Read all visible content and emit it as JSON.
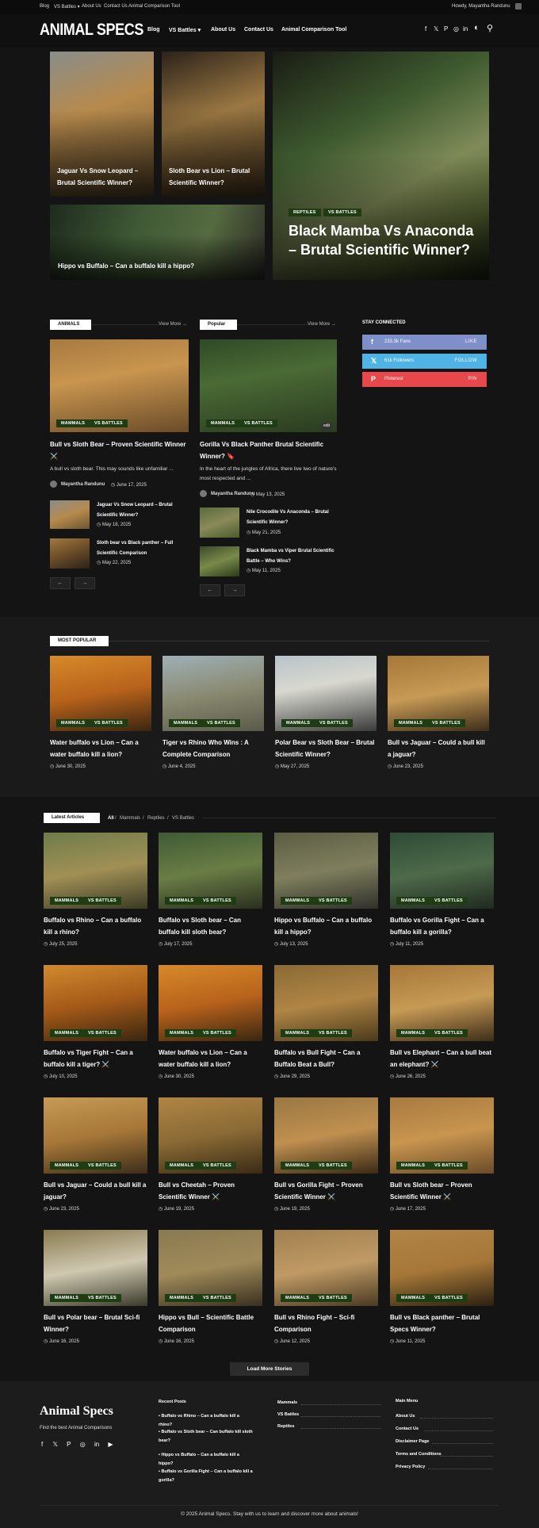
{
  "topbar": {
    "links": [
      "Blog",
      "VS Battles ▾",
      "About Us",
      "Contact Us",
      "Animal Comparison Tool"
    ],
    "greeting": "Howdy, Mayantha Randunu"
  },
  "header": {
    "logo": "ANIMAL SPECS",
    "nav": [
      "Blog",
      "VS Battles ▾",
      "About Us",
      "Contact Us",
      "Animal Comparison Tool"
    ],
    "icons": [
      "f",
      "𝕏",
      "P",
      "◎",
      "in",
      "◐",
      "⚲"
    ]
  },
  "hero": {
    "small": [
      {
        "title": "Jaguar Vs Snow Leopard – Brutal Scientific Winner?"
      },
      {
        "title": "Sloth Bear vs Lion – Brutal Scientific Winner?"
      },
      {
        "title": "Hippo vs Buffalo – Can a buffalo kill a hippo?"
      }
    ],
    "big": {
      "tags": [
        "REPTILES",
        "VS BATTLES"
      ],
      "title": "Black Mamba Vs Anaconda – Brutal Scientific Winner?"
    }
  },
  "animals": {
    "label": "ANIMALS",
    "view_more": "View More →",
    "main": {
      "tags": [
        "MAMMALS",
        "VS BATTLES"
      ],
      "title": "Bull vs Sloth Bear – Proven Scientific Winner ⚔️",
      "excerpt": "A bull vs sloth bear. This may sounds like unfamiliar ...",
      "author": "Mayantha Randunu",
      "date": "June 17, 2025"
    },
    "list": [
      {
        "title": "Jaguar Vs Snow Leopard – Brutal Scientific Winner?",
        "date": "May 18, 2025"
      },
      {
        "title": "Sloth bear vs Black panther – Full Scientific Comparison",
        "date": "May 22, 2025"
      }
    ],
    "prev": "←",
    "next": "→"
  },
  "popular": {
    "label": "Popular",
    "view_more": "View More →",
    "main": {
      "tags": [
        "MAMMALS",
        "VS BATTLES"
      ],
      "edit": "edit",
      "title": "Gorilla Vs Black Panther Brutal Scientific Winner? 🔖",
      "excerpt": "In the heart of the jungles of Africa, there live two of nature's most respected and ...",
      "author": "Mayantha Randunu",
      "date": "May 13, 2025"
    },
    "list": [
      {
        "title": "Nile Crocodile Vs Anaconda – Brutal Scientific Winner?",
        "date": "May 21, 2025"
      },
      {
        "title": "Black Mamba vs Viper Brutal Scientific Battle – Who Wins?",
        "date": "May 11, 2025"
      }
    ],
    "prev": "←",
    "next": "→"
  },
  "stay": {
    "label": "STAY CONNECTED",
    "items": [
      {
        "icon": "f",
        "count": "233.3k Fans",
        "action": "LIKE",
        "color": "#7f8fc9"
      },
      {
        "icon": "𝕏",
        "count": "61k Followers",
        "action": "FOLLOW",
        "color": "#4fb3e6"
      },
      {
        "icon": "P",
        "count": "Pinterest",
        "action": "PIN",
        "color": "#e8474c"
      }
    ]
  },
  "most_popular": {
    "label": "MOST POPULAR",
    "items": [
      {
        "tags": [
          "MAMMALS",
          "VS BATTLES"
        ],
        "title": "Water buffalo vs Lion – Can a water buffalo kill a lion?",
        "date": "June 30, 2025"
      },
      {
        "tags": [
          "MAMMALS",
          "VS BATTLES"
        ],
        "title": "Tiger vs Rhino Who Wins : A Complete Comparison",
        "date": "June 4, 2025"
      },
      {
        "tags": [
          "MAMMALS",
          "VS BATTLES"
        ],
        "title": "Polar Bear vs Sloth Bear – Brutal Scientific Winner?",
        "date": "May 27, 2025"
      },
      {
        "tags": [
          "MAMMALS",
          "VS BATTLES"
        ],
        "title": "Bull vs Jaguar – Could a bull kill a jaguar?",
        "date": "June 23, 2025"
      }
    ]
  },
  "latest": {
    "label": "Latest Articles",
    "filters": [
      "All",
      "Mammals",
      "Reptiles",
      "VS Battles"
    ],
    "items": [
      {
        "title": "Buffalo vs Rhino – Can a buffalo kill a rhino?",
        "date": "July 25, 2025"
      },
      {
        "title": "Buffalo vs Sloth bear – Can buffalo kill sloth bear?",
        "date": "July 17, 2025"
      },
      {
        "title": "Hippo vs Buffalo – Can a buffalo kill a hippo?",
        "date": "July 13, 2025"
      },
      {
        "title": "Buffalo vs Gorilla Fight – Can a buffalo kill a gorilla?",
        "date": "July 11, 2025"
      },
      {
        "title": "Buffalo vs Tiger Fight – Can a buffalo kill a tiger? ⚔️",
        "date": "July 10, 2025"
      },
      {
        "title": "Water buffalo vs Lion – Can a water buffalo kill a lion?",
        "date": "June 30, 2025"
      },
      {
        "title": "Buffalo vs Bull Fight – Can a Buffalo Beat a Bull?",
        "date": "June 29, 2025"
      },
      {
        "title": "Bull vs Elephant – Can a bull beat an elephant? ⚔️",
        "date": "June 26, 2025"
      },
      {
        "title": "Bull vs Jaguar – Could a bull kill a jaguar?",
        "date": "June 23, 2025"
      },
      {
        "title": "Bull vs Cheetah – Proven Scientific Winner ⚔️",
        "date": "June 19, 2025"
      },
      {
        "title": "Bull vs Gorilla Fight – Proven Scientific Winner ⚔️",
        "date": "June 19, 2025"
      },
      {
        "title": "Bull vs Sloth bear – Proven Scientific Winner ⚔️",
        "date": "June 17, 2025"
      },
      {
        "title": "Bull vs Polar bear – Brutal Sci-fi Winner?",
        "date": "June 16, 2025"
      },
      {
        "title": "Hippo vs Bull – Scientific Battle Comparison",
        "date": "June 16, 2025"
      },
      {
        "title": "Bull vs Rhino Fight – Sci-fi Comparison",
        "date": "June 12, 2025"
      },
      {
        "title": "Bull vs Black panther – Brutal Specs Winner?",
        "date": "June 11, 2025"
      }
    ],
    "tag_left": "MAMMALS",
    "tag_right": "VS BATTLES",
    "load_more": "Load More Stories"
  },
  "footer": {
    "brand": "Animal Specs",
    "tagline": "Find the best Animal Comparisons",
    "social": [
      "f",
      "𝕏",
      "P",
      "◎",
      "in",
      "▶"
    ],
    "recent_label": "Recent Posts",
    "recent": [
      "Buffalo vs Rhino – Can a buffalo kill a rhino?",
      "Buffalo vs Sloth bear – Can buffalo kill sloth bear?",
      "Hippo vs Buffalo – Can a buffalo kill a hippo?",
      "Buffalo vs Gorilla Fight – Can a buffalo kill a gorilla?"
    ],
    "cats": [
      "Mammals",
      "VS Battles",
      "Reptiles"
    ],
    "menu_label": "Main Menu",
    "menu": [
      "About Us",
      "Contact Us",
      "Disclaimer Page",
      "Terms and Conditions",
      "Privacy Policy"
    ],
    "copyright": "© 2025 Animal Specs. Stay with us to learn and discover more about animals!"
  }
}
